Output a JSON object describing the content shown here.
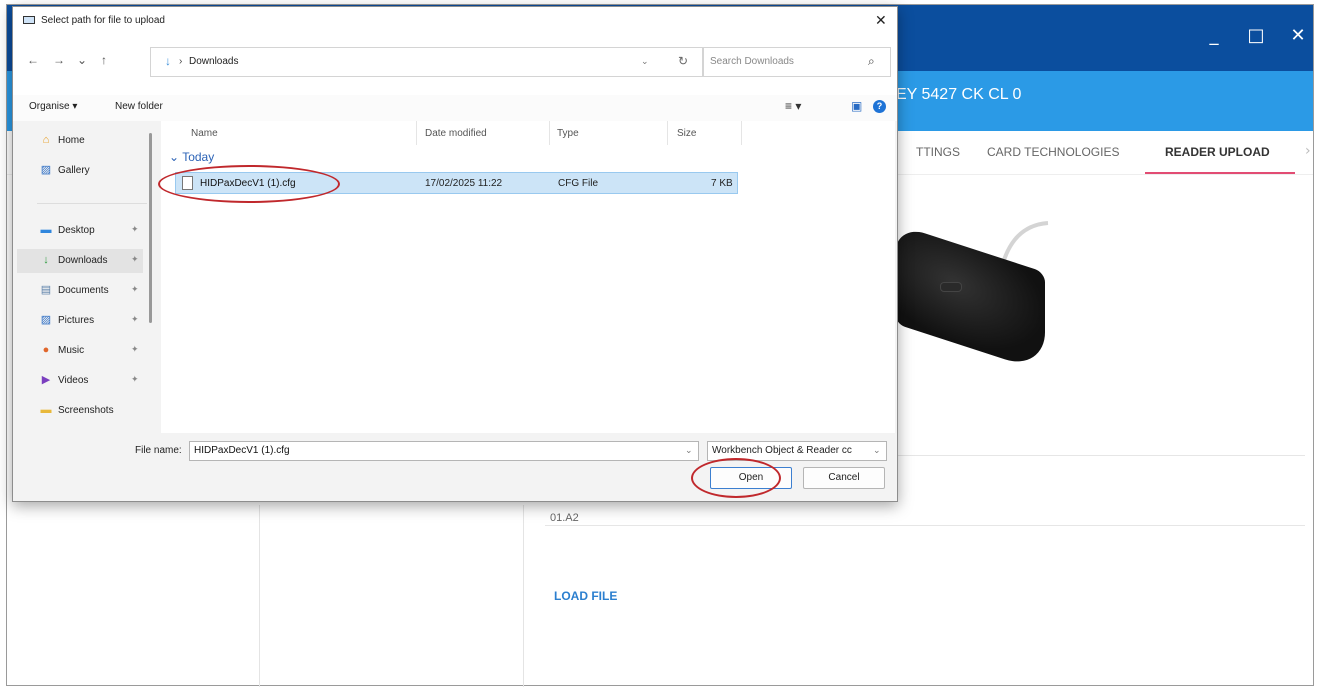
{
  "app": {
    "title": "EY 5427 CK CL 0",
    "window_controls": [
      "_",
      "□",
      "✕"
    ],
    "tabs": [
      {
        "label": "TTINGS"
      },
      {
        "label": "CARD TECHNOLOGIES"
      },
      {
        "label": "READER UPLOAD"
      }
    ],
    "tab_next": "›",
    "version": "01.A2",
    "load_file": "LOAD FILE"
  },
  "dialog": {
    "title": "Select path for file to upload",
    "close": "✕",
    "nav": {
      "back": "←",
      "forward": "→",
      "recent": "⌄",
      "up": "↑"
    },
    "address": {
      "icon": "↓",
      "separator": "›",
      "path": "Downloads",
      "dropdown": "⌄",
      "refresh": "↻"
    },
    "search": {
      "placeholder": "Search Downloads",
      "icon": "⌕"
    },
    "commands": {
      "organise": "Organise ▾",
      "new_folder": "New folder",
      "view": "≡ ▾",
      "pane": "▣",
      "help": "?"
    },
    "sidebar": [
      {
        "label": "Home",
        "icon": "home-icon",
        "glyph": "⌂"
      },
      {
        "label": "Gallery",
        "icon": "gallery-icon",
        "glyph": "▨"
      },
      {
        "label": "Desktop",
        "icon": "desktop-icon",
        "glyph": "▬",
        "pinned": true
      },
      {
        "label": "Downloads",
        "icon": "downloads-icon",
        "glyph": "↓",
        "pinned": true,
        "selected": true
      },
      {
        "label": "Documents",
        "icon": "documents-icon",
        "glyph": "▤",
        "pinned": true
      },
      {
        "label": "Pictures",
        "icon": "pictures-icon",
        "glyph": "▨",
        "pinned": true
      },
      {
        "label": "Music",
        "icon": "music-icon",
        "glyph": "●",
        "pinned": true
      },
      {
        "label": "Videos",
        "icon": "videos-icon",
        "glyph": "▶",
        "pinned": true
      },
      {
        "label": "Screenshots",
        "icon": "folder-icon",
        "glyph": "▬"
      }
    ],
    "pin_glyph": "✦",
    "columns": {
      "name": "Name",
      "date": "Date modified",
      "type": "Type",
      "size": "Size"
    },
    "group": "Today",
    "group_chevron": "⌄",
    "files": [
      {
        "name": "HIDPaxDecV1 (1).cfg",
        "date": "17/02/2025 11:22",
        "type": "CFG File",
        "size": "7 KB"
      }
    ],
    "filename_label": "File name:",
    "filename_value": "HIDPaxDecV1 (1).cfg",
    "filetype": "Workbench Object & Reader cc",
    "open": "Open",
    "cancel": "Cancel"
  },
  "colors": {
    "titlebar": "#0b4e9e",
    "header": "#2b9ae6",
    "tab_active_underline": "#e24c73",
    "selection": "#cce4f7",
    "annotation": "#c0282c"
  }
}
